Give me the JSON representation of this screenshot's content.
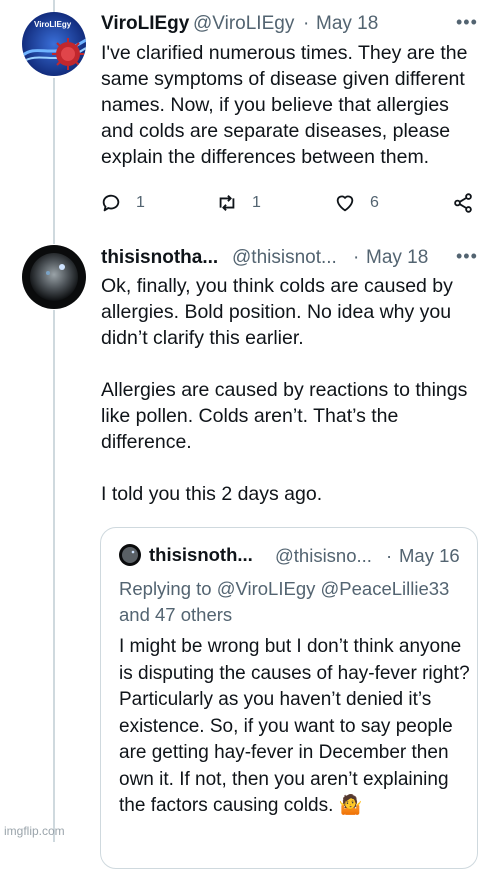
{
  "tweet1": {
    "display_name": "ViroLIEgy",
    "handle": "@ViroLIEgy",
    "separator": "·",
    "date": "May 18",
    "more_icon": "more-dots-icon",
    "avatar_text": "ViroLIEgy",
    "text": "I've clarified numerous times. They are the same symptoms of disease given different names. Now, if you believe that allergies and colds are separate diseases, please explain the differences between them.",
    "actions": {
      "reply_count": "1",
      "retweet_count": "1",
      "like_count": "6"
    }
  },
  "tweet2": {
    "display_name": "thisisnotha...",
    "handle": "@thisisnot...",
    "separator": "·",
    "date": "May 18",
    "text": "Ok, finally, you think colds are caused by allergies. Bold position. No idea why you didn’t clarify this earlier.\n\nAllergies are caused by reactions to things like pollen. Colds aren’t. That’s the difference.\n\nI told you this 2 days ago.",
    "quote": {
      "display_name": "thisisnoth...",
      "handle": "@thisisno...",
      "separator": "·",
      "date": "May 16",
      "replying_to_label": "Replying to",
      "reply_handles": "@ViroLIEgy @PeaceLillie33",
      "reply_others": "and 47 others",
      "text": "I might be wrong but I don’t think anyone is disputing the causes of hay-fever right? Particularly as you haven’t denied it’s existence. So, if you want to say people are getting hay-fever in December then own it. If not, then you aren’t explaining the factors causing colds.",
      "emoji": "🤷"
    }
  },
  "watermark": "imgflip.com",
  "colors": {
    "text_primary": "#0f1419",
    "text_secondary": "#536471",
    "link": "#1d9bf0",
    "border": "#cfd9de"
  }
}
